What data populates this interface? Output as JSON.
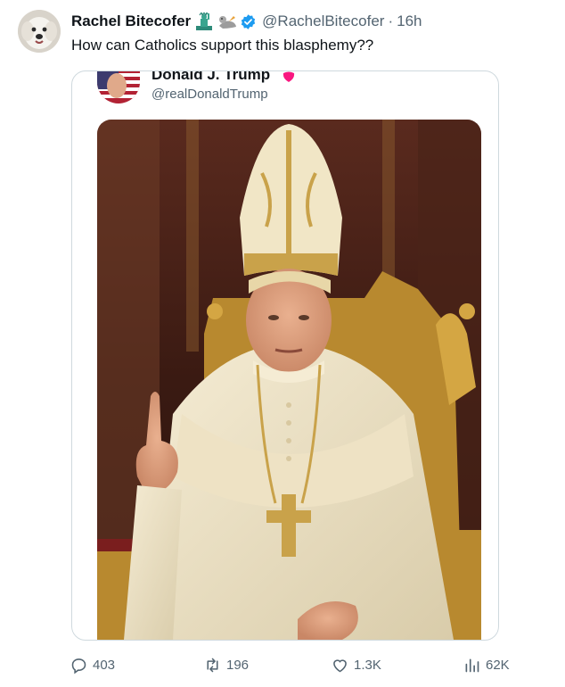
{
  "tweet": {
    "author_name": "Rachel Bitecofer",
    "author_handle": "@RachelBitecofer",
    "separator": "·",
    "time": "16h",
    "text": "How can Catholics support this blasphemy??",
    "name_emojis": [
      "statue-of-liberty",
      "seal"
    ],
    "verified": true,
    "accent_color": "#1d9bf0"
  },
  "quoted_post": {
    "author_name": "Donald J. Trump",
    "author_handle": "@realDonaldTrump",
    "badge_color": "#f91880",
    "image_description_icon": "pope-portrait-image"
  },
  "actions": {
    "replies": "403",
    "reposts": "196",
    "likes": "1.3K",
    "views": "62K"
  },
  "colors": {
    "text_primary": "#0f1419",
    "text_secondary": "#536471",
    "border": "#cfd9de"
  }
}
